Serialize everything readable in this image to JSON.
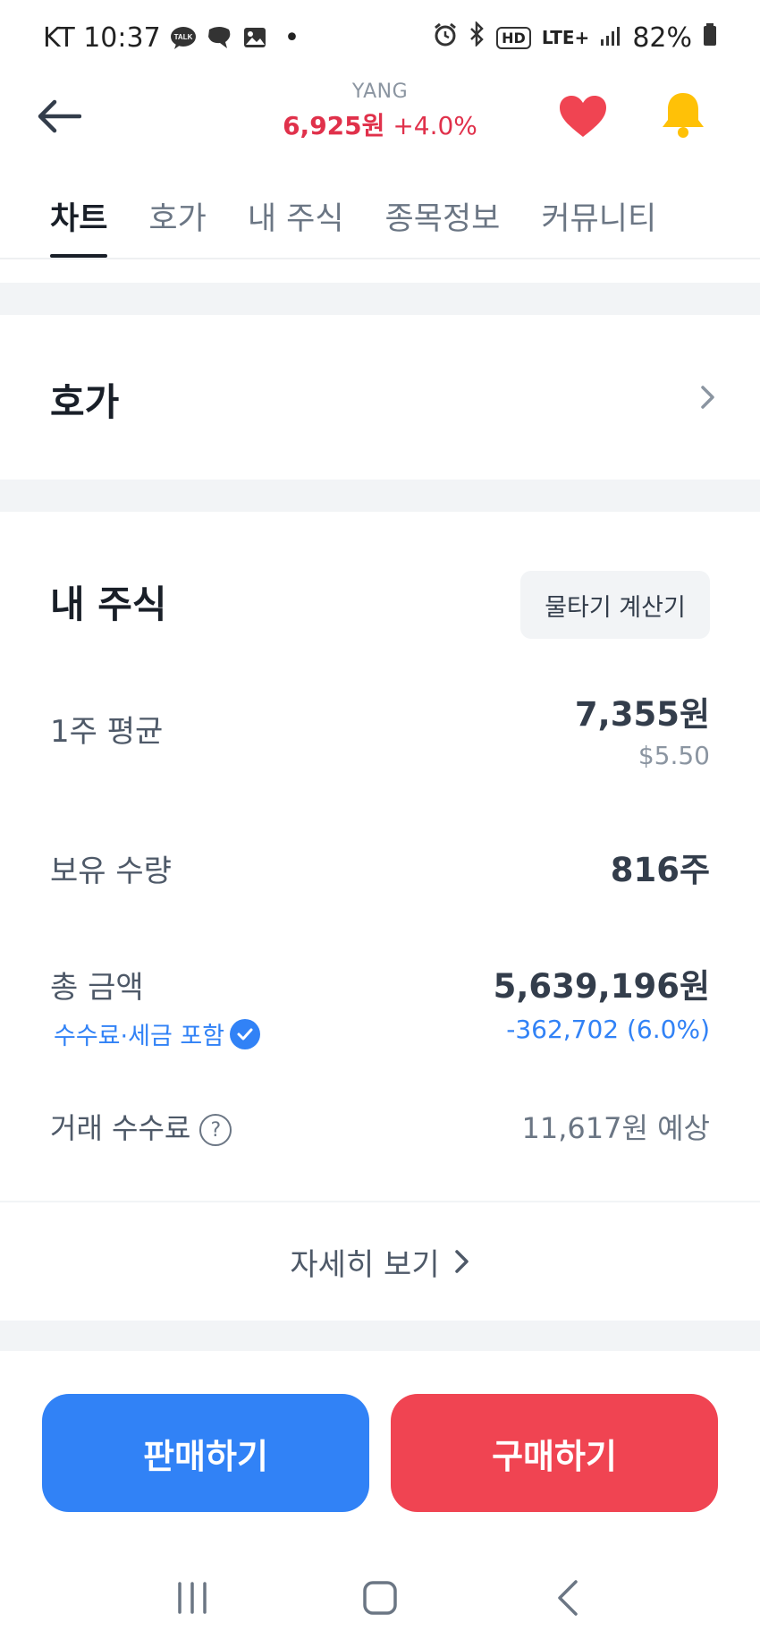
{
  "status_bar": {
    "carrier_time": "KT 10:37",
    "talk_badge": "TALK",
    "dot": "•",
    "hd": "HD",
    "network": "LTE+",
    "battery": "82%"
  },
  "header": {
    "ticker": "YANG",
    "price": "6,925원",
    "change": "+4.0%"
  },
  "tabs": [
    {
      "label": "차트",
      "active": true
    },
    {
      "label": "호가",
      "active": false
    },
    {
      "label": "내 주식",
      "active": false
    },
    {
      "label": "종목정보",
      "active": false
    },
    {
      "label": "커뮤니티",
      "active": false
    }
  ],
  "hoga_section": {
    "title": "호가"
  },
  "my_stock": {
    "title": "내 주식",
    "calc_button": "물타기 계산기",
    "avg_label": "1주 평균",
    "avg_value": "7,355원",
    "avg_usd": "$5.50",
    "qty_label": "보유 수량",
    "qty_value": "816주",
    "total_label": "총 금액",
    "fee_tax_tag": "수수료·세금 포함",
    "total_value": "5,639,196원",
    "total_change": "-362,702 (6.0%)",
    "fee_label": "거래 수수료",
    "help_glyph": "?",
    "fee_value": "11,617원 예상",
    "more_label": "자세히 보기"
  },
  "actions": {
    "sell_label": "판매하기",
    "buy_label": "구매하기"
  },
  "colors": {
    "up_red": "#e0314b",
    "down_blue": "#3182f6",
    "sell_blue": "#3182f6",
    "buy_red": "#f04452",
    "heart": "#f04452",
    "bell": "#ffc107"
  },
  "icons": {
    "back": "back-arrow-icon",
    "favorite": "heart-icon",
    "alert": "bell-icon",
    "chevron": "chevron-right-icon",
    "check": "check-icon",
    "help": "help-icon",
    "nav_recent": "recent-apps-icon",
    "nav_home": "home-icon",
    "nav_back": "nav-back-icon"
  }
}
